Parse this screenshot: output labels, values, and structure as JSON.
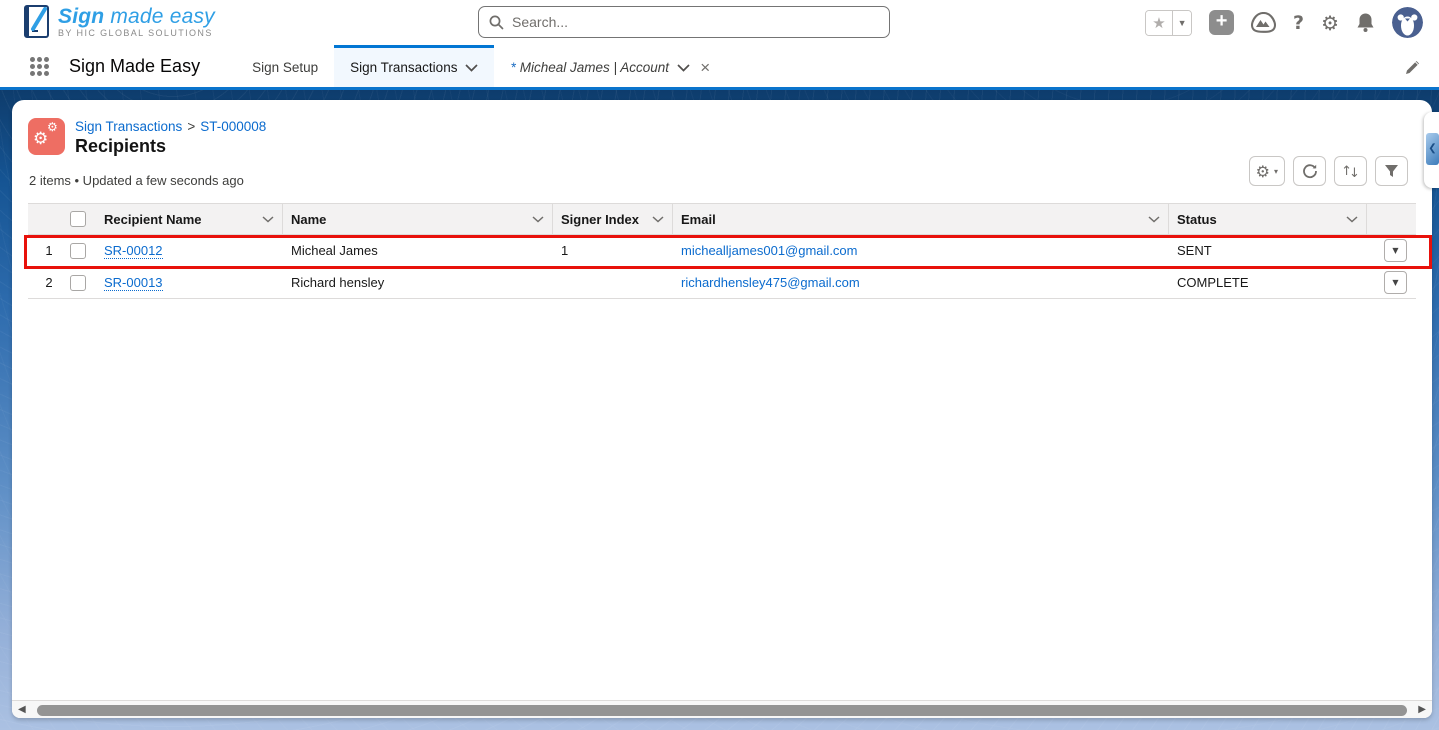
{
  "global_header": {
    "logo": {
      "title_bold": "Sign",
      "title_rest": " made easy",
      "subtitle": "BY HIC GLOBAL SOLUTIONS"
    },
    "search": {
      "placeholder": "Search...",
      "value": ""
    },
    "icons": {
      "favorites": "star-icon",
      "favorites_menu": "caret-down-icon",
      "create": "plus-icon",
      "guidance": "trailhead-icon",
      "help": "question-icon",
      "setup": "gear-icon",
      "notifications": "bell-icon",
      "profile": "astro-avatar"
    },
    "glyphs": {
      "star": "★",
      "caret": "▼",
      "plus": "+",
      "help": "?",
      "gear": "⚙"
    }
  },
  "nav": {
    "app_name": "Sign Made Easy",
    "tabs": [
      {
        "label": "Sign Setup"
      },
      {
        "label": "Sign Transactions"
      },
      {
        "prefix": "*",
        "label": "Micheal James | Account"
      }
    ],
    "edit_icon": "pencil-icon"
  },
  "page": {
    "breadcrumb": {
      "parent": "Sign Transactions",
      "separator": ">",
      "current": "ST-000008"
    },
    "title": "Recipients",
    "meta": "2 items • Updated a few seconds ago",
    "entity_icon": "gears-icon",
    "colors": {
      "entity_icon_bg": "#ee6e63",
      "accent": "#0176d3",
      "link": "#0b6bce",
      "highlight": "#e8110b"
    }
  },
  "list_controls": {
    "icons": [
      "list-settings-gear-icon",
      "refresh-icon",
      "sort-icon",
      "filter-icon"
    ],
    "glyphs": {
      "gear": "⚙",
      "caret": "▾",
      "up": "↑",
      "down": "↓"
    }
  },
  "table": {
    "columns": [
      "Recipient Name",
      "Name",
      "Signer Index",
      "Email",
      "Status"
    ],
    "rows": [
      {
        "num": "1",
        "recipient": "SR-00012",
        "name": "Micheal James",
        "signer_index": "1",
        "email": "michealljames001@gmail.com",
        "status": "SENT",
        "highlighted": true
      },
      {
        "num": "2",
        "recipient": "SR-00013",
        "name": "Richard hensley",
        "signer_index": "",
        "email": "richardhensley475@gmail.com",
        "status": "COMPLETE",
        "highlighted": false
      }
    ],
    "row_action_glyph": "▼"
  },
  "scrollbar": {
    "left_arrow": "◀",
    "right_arrow": "▶"
  }
}
